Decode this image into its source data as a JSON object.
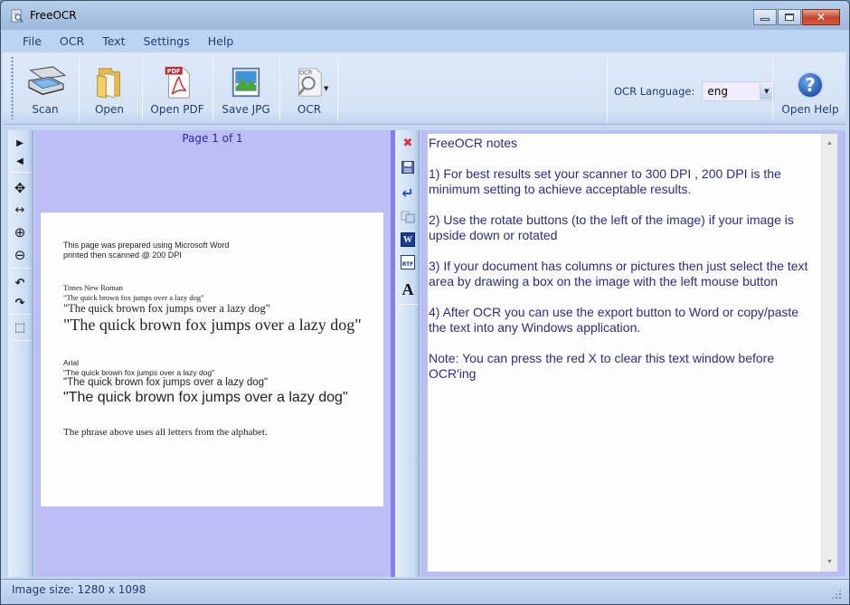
{
  "window": {
    "title": "FreeOCR",
    "controls": {
      "minimize": "minimize",
      "maximize": "maximize",
      "close": "✕"
    }
  },
  "menu": [
    "File",
    "OCR",
    "Text",
    "Settings",
    "Help"
  ],
  "toolbar": {
    "buttons": [
      {
        "id": "scan",
        "label": "Scan",
        "icon": "scanner-icon"
      },
      {
        "id": "open",
        "label": "Open",
        "icon": "folder-icon"
      },
      {
        "id": "open-pdf",
        "label": "Open PDF",
        "icon": "pdf-icon"
      },
      {
        "id": "save-jpg",
        "label": "Save JPG",
        "icon": "image-icon"
      },
      {
        "id": "ocr",
        "label": "OCR",
        "icon": "ocr-magnifier-icon",
        "has_dropdown": true
      }
    ],
    "pdf_badge": "PDF",
    "ocr_badge": "OCR",
    "ocr_language": {
      "label": "OCR Language:",
      "value": "eng"
    },
    "help": {
      "label": "Open Help",
      "glyph": "?"
    }
  },
  "image_tools": [
    {
      "name": "next-page-button",
      "glyph": "▶"
    },
    {
      "name": "previous-page-button",
      "glyph": "◀"
    },
    {
      "name": "pan-button",
      "glyph": "✥"
    },
    {
      "name": "fit-width-button",
      "glyph": "↔"
    },
    {
      "name": "zoom-in-button",
      "glyph": "⊕"
    },
    {
      "name": "zoom-out-button",
      "glyph": "⊖"
    },
    {
      "name": "rotate-left-button",
      "glyph": "↶"
    },
    {
      "name": "rotate-right-button",
      "glyph": "↷"
    },
    {
      "name": "select-area-button",
      "glyph": "⬚"
    }
  ],
  "image_pane": {
    "page_indicator": "Page 1 of 1",
    "scanned_page": {
      "intro_line1": "This page was prepared using Microsoft Word",
      "intro_line2": "printed then scanned @ 200 DPI",
      "times_heading": "Times New Roman",
      "times_small": "\"The quick brown fox jumps over a lazy dog\"",
      "times_medium": "\"The quick brown fox jumps over a lazy dog\"",
      "times_large": "\"The quick brown fox jumps over a lazy dog\"",
      "arial_heading": "Arial",
      "arial_small": "\"The quick brown fox jumps over a lazy dog\"",
      "arial_medium": "\"The quick brown fox  jumps over a lazy dog\"",
      "arial_large": "\"The quick brown fox jumps over a lazy dog\"",
      "footer": "The phrase above uses all letters from the alphabet."
    }
  },
  "text_tools": [
    {
      "name": "clear-text-button",
      "glyph": "✖",
      "color": "#e0303a"
    },
    {
      "name": "save-text-button",
      "glyph": "💾"
    },
    {
      "name": "insert-line-button",
      "glyph": "↵",
      "color": "#1a4fd0"
    },
    {
      "name": "copy-button",
      "glyph": "⎘"
    },
    {
      "name": "export-word-button",
      "glyph": "W"
    },
    {
      "name": "export-rtf-button",
      "glyph": "RTF"
    },
    {
      "name": "font-button",
      "glyph": "A"
    }
  ],
  "text_pane": {
    "paragraphs": [
      "FreeOCR notes",
      "1) For best results set your scanner to 300 DPI , 200 DPI is the minimum setting to achieve acceptable results.",
      "2) Use the rotate buttons (to the left of the image) if your image is upside down or rotated",
      "3) If your document has columns or pictures then just select the text area by drawing a box on the image with the left mouse button",
      "4) After OCR you can use the export button to Word or copy/paste the text into any Windows application.",
      "Note: You can press the red X to clear this text window before OCR'ing"
    ]
  },
  "status": {
    "image_size": "Image size:  1280 x 1098"
  },
  "colors": {
    "pane_background": "#bdbdf6",
    "text_color": "#2c2c8c",
    "clear_red": "#e0303a",
    "splitter": "#8282ee"
  }
}
